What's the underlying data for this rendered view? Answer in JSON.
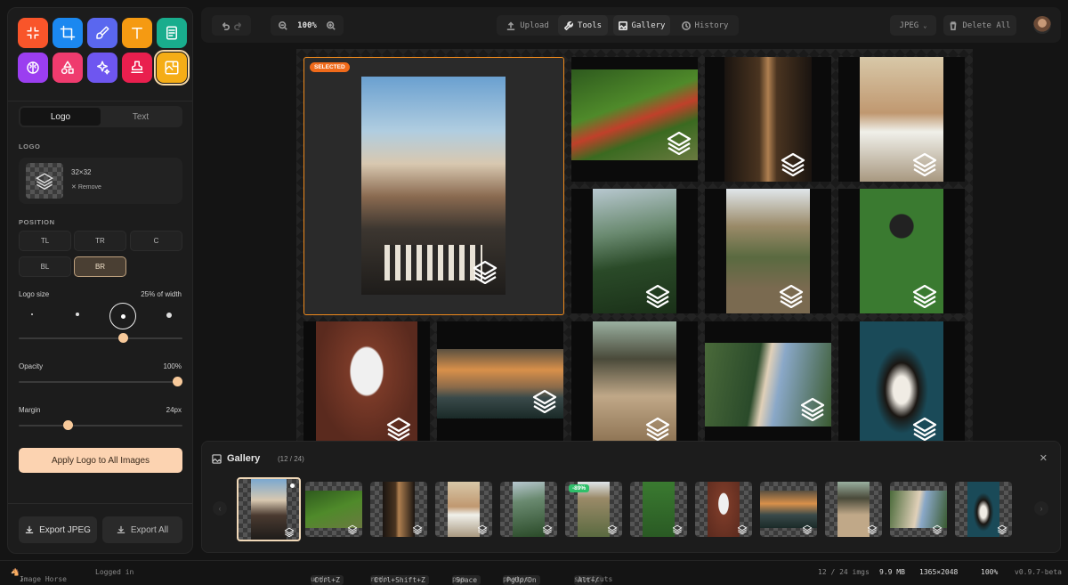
{
  "tools": [
    {
      "icon": "compress-icon",
      "color": "#f9552a"
    },
    {
      "icon": "crop-icon",
      "color": "#1b88f0"
    },
    {
      "icon": "brush-icon",
      "color": "#5a67ef"
    },
    {
      "icon": "text-icon",
      "color": "#f59a12"
    },
    {
      "icon": "document-icon",
      "color": "#19ad8d"
    },
    {
      "icon": "brain-icon",
      "color": "#9b3ef0"
    },
    {
      "icon": "shapes-icon",
      "color": "#ef3b6e"
    },
    {
      "icon": "sparkles-icon",
      "color": "#6e56f0"
    },
    {
      "icon": "stamp-icon",
      "color": "#e91f4e"
    },
    {
      "icon": "logo-overlay-icon",
      "color": "#f5ad16"
    }
  ],
  "tabs": {
    "logo": "Logo",
    "text": "Text"
  },
  "logo_section": {
    "title": "LOGO",
    "size": "32×32",
    "remove": "Remove"
  },
  "position": {
    "title": "POSITION",
    "options": [
      "TL",
      "TR",
      "C",
      "BL",
      "BR"
    ],
    "selected": "BR"
  },
  "logo_size": {
    "label": "Logo size",
    "value": "25% of width",
    "level": 0.66
  },
  "opacity": {
    "label": "Opacity",
    "value": "100%",
    "level": 1.0
  },
  "margin": {
    "label": "Margin",
    "value": "24px",
    "level": 0.31
  },
  "apply_button": "Apply Logo to All Images",
  "export": {
    "jpeg": "Export JPEG",
    "all": "Export All"
  },
  "topbar": {
    "zoom": "100%",
    "upload": "Upload",
    "tools": "Tools",
    "gallery": "Gallery",
    "history": "History",
    "format": "JPEG",
    "delete_all": "Delete All"
  },
  "canvas": {
    "selected_badge": "SELECTED"
  },
  "gallery": {
    "title": "Gallery",
    "count": "(12 / 24)",
    "badge": "-89%"
  },
  "status": {
    "app": "Image Horse",
    "login": "Logged in",
    "k_undo": "Ctrl+Z",
    "undo": "undo",
    "k_redo": "Ctrl+Shift+Z",
    "redo": "redo",
    "k_pan": "Space",
    "pan": "pan",
    "k_photos": "PgUp/Dn",
    "photos": "photos",
    "k_short": "Alt+/",
    "shortcuts": "shortcuts",
    "imgs": "12 / 24 imgs",
    "size": "9.9 MB",
    "dims": "1365×2048",
    "zoom": "100%",
    "version": "v0.9.7-beta"
  }
}
